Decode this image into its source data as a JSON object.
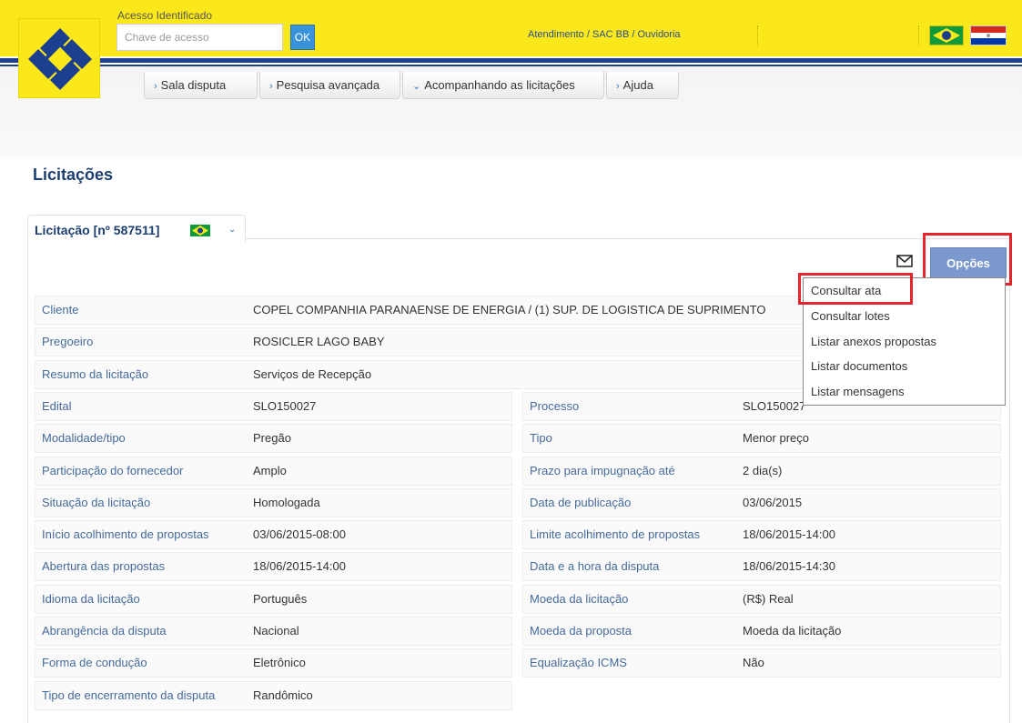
{
  "header": {
    "access_label": "Acesso Identificado",
    "access_placeholder": "Chave de acesso",
    "ok_label": "OK",
    "atendimento_link": "Atendimento / SAC BB / Ouvidoria"
  },
  "nav": {
    "tabs": [
      {
        "label": "Sala disputa",
        "arrow": "›"
      },
      {
        "label": "Pesquisa avançada",
        "arrow": "›"
      },
      {
        "label": "Acompanhando as licitações",
        "arrow": "⌄"
      },
      {
        "label": "Ajuda",
        "arrow": "›"
      }
    ]
  },
  "page_title": "Licitações",
  "panel": {
    "tab_title": "Licitação [nº 587511]",
    "options_label": "Opções",
    "menu_items": [
      "Consultar ata",
      "Consultar lotes",
      "Listar anexos propostas",
      "Listar documentos",
      "Listar mensagens"
    ]
  },
  "details": {
    "full_rows": [
      {
        "label": "Cliente",
        "value": "COPEL COMPANHIA PARANAENSE DE ENERGIA  / (1)  SUP. DE LOGISTICA DE SUPRIMENTO"
      },
      {
        "label": "Pregoeiro",
        "value": "ROSICLER LAGO BABY"
      },
      {
        "label": "Resumo da licitação",
        "value": "Serviços de Recepção"
      }
    ],
    "pair_rows": [
      {
        "l1": "Edital",
        "v1": "SLO150027",
        "l2": "Processo",
        "v2": "SLO150027"
      },
      {
        "l1": "Modalidade/tipo",
        "v1": "Pregão",
        "l2": "Tipo",
        "v2": "Menor preço"
      },
      {
        "l1": "Participação do fornecedor",
        "v1": "Amplo",
        "l2": "Prazo para impugnação até",
        "v2": "2 dia(s)"
      },
      {
        "l1": "Situação da licitação",
        "v1": "Homologada",
        "l2": "Data de publicação",
        "v2": "03/06/2015"
      },
      {
        "l1": "Início acolhimento de propostas",
        "v1": "03/06/2015-08:00",
        "l2": "Limite acolhimento de propostas",
        "v2": "18/06/2015-14:00"
      },
      {
        "l1": "Abertura das propostas",
        "v1": "18/06/2015-14:00",
        "l2": "Data e a hora da disputa",
        "v2": "18/06/2015-14:30"
      },
      {
        "l1": "Idioma da licitação",
        "v1": "Português",
        "l2": "Moeda da licitação",
        "v2": "(R$) Real"
      },
      {
        "l1": "Abrangência da disputa",
        "v1": "Nacional",
        "l2": "Moeda da proposta",
        "v2": "Moeda da licitação"
      },
      {
        "l1": "Forma de condução",
        "v1": "Eletrônico",
        "l2": "Equalização ICMS",
        "v2": "Não"
      }
    ],
    "last_row": {
      "label": "Tipo de encerramento da disputa",
      "value": "Randômico"
    }
  }
}
